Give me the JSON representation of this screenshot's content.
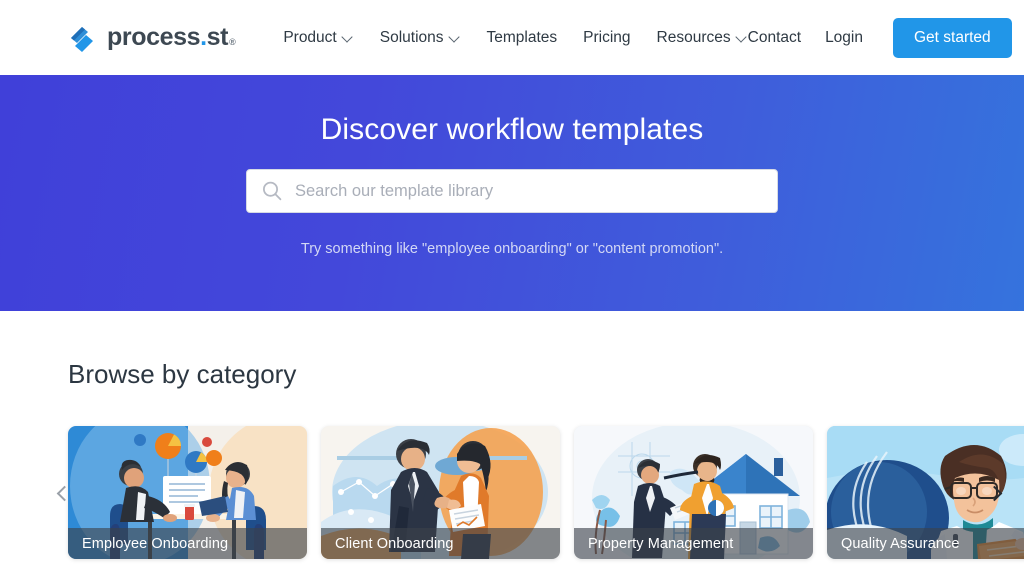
{
  "brand": {
    "name_main": "process",
    "name_dot": ".",
    "name_suffix": "st",
    "trademark": "®",
    "accent_color": "#2196e8",
    "logo_icon": "process-st-slash-logo"
  },
  "header": {
    "nav": [
      {
        "label": "Product",
        "has_dropdown": true,
        "icon": "chevron-down-icon"
      },
      {
        "label": "Solutions",
        "has_dropdown": true,
        "icon": "chevron-down-icon"
      },
      {
        "label": "Templates",
        "has_dropdown": false
      },
      {
        "label": "Pricing",
        "has_dropdown": false
      },
      {
        "label": "Resources",
        "has_dropdown": true,
        "icon": "chevron-down-icon"
      }
    ],
    "contact_label": "Contact",
    "login_label": "Login",
    "cta_label": "Get started",
    "cta_color": "#2196e8"
  },
  "hero": {
    "title": "Discover workflow templates",
    "gradient_from": "#4040d9",
    "gradient_to": "#3573dd",
    "search": {
      "placeholder": "Search our template library",
      "value": "",
      "icon": "search-icon"
    },
    "hint": "Try something like \"employee onboarding\" or \"content promotion\"."
  },
  "browse": {
    "title": "Browse by category",
    "prev_icon": "chevron-left-icon",
    "next_icon": "chevron-right-icon",
    "cards": [
      {
        "label": "Employee Onboarding",
        "art": "two-people-at-table-with-laptop-and-charts"
      },
      {
        "label": "Client Onboarding",
        "art": "business-handshake-with-documents"
      },
      {
        "label": "Property Management",
        "art": "two-people-in-front-of-house"
      },
      {
        "label": "Quality Assurance",
        "art": "woman-in-lab-coat-with-clipboard"
      }
    ]
  }
}
